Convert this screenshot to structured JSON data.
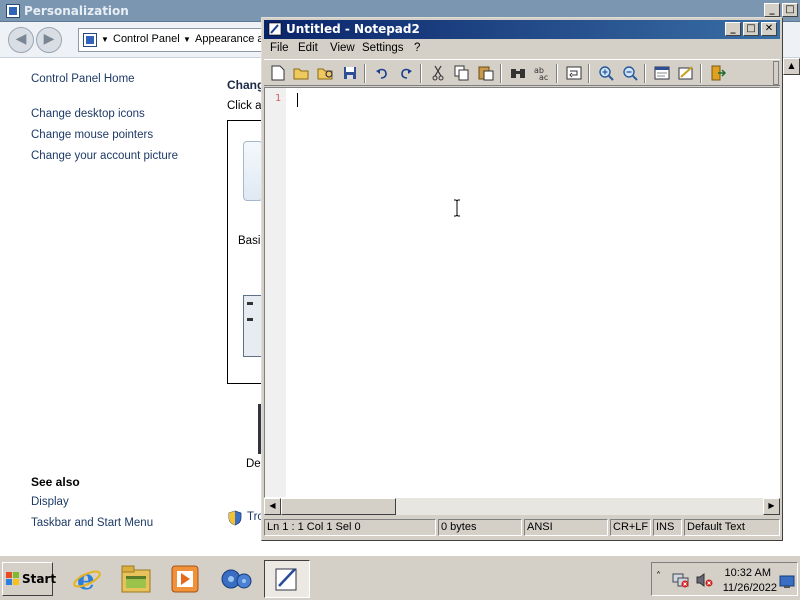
{
  "background_window": {
    "title": "Personalization",
    "address": {
      "crumbs": [
        "Control Panel",
        "Appearance a"
      ]
    },
    "sidebar": {
      "home": "Control Panel Home",
      "links": [
        "Change desktop icons",
        "Change mouse pointers",
        "Change your account picture"
      ],
      "see_also_heading": "See also",
      "see_also": [
        "Display",
        "Taskbar and Start Menu"
      ]
    },
    "main": {
      "heading": "Chang",
      "subtext": "Click a",
      "theme_label": "Basi",
      "lower_label": "De",
      "troubleshoot": "Tro"
    }
  },
  "notepad": {
    "title": "Untitled - Notepad2",
    "menu": [
      "File",
      "Edit",
      "View",
      "Settings",
      "?"
    ],
    "toolbar_icons": [
      "new-file-icon",
      "open-folder-icon",
      "browse-icon",
      "save-icon",
      "undo-icon",
      "redo-icon",
      "cut-icon",
      "copy-icon",
      "paste-icon",
      "find-icon",
      "replace-icon",
      "word-wrap-icon",
      "zoom-in-icon",
      "zoom-out-icon",
      "view-scheme-icon",
      "customize-schemes-icon",
      "exit-icon"
    ],
    "editor": {
      "line_number": "1",
      "content": ""
    },
    "status": {
      "position": "Ln 1 : 1   Col 1   Sel 0",
      "size": "0 bytes",
      "encoding": "ANSI",
      "line_ending": "CR+LF",
      "mode": "INS",
      "scheme": "Default Text"
    }
  },
  "taskbar": {
    "start_label": "Start",
    "apps": [
      "internet-explorer-icon",
      "file-explorer-icon",
      "media-player-icon",
      "control-panel-icon",
      "notepad-icon"
    ],
    "tray": {
      "time": "10:32 AM",
      "date": "11/26/2022"
    }
  },
  "colors": {
    "titlebar_active": "#0a246a",
    "titlebar_gradient_end": "#3a6ea5",
    "link_blue": "#1e3a66",
    "line_number": "#d36060"
  }
}
